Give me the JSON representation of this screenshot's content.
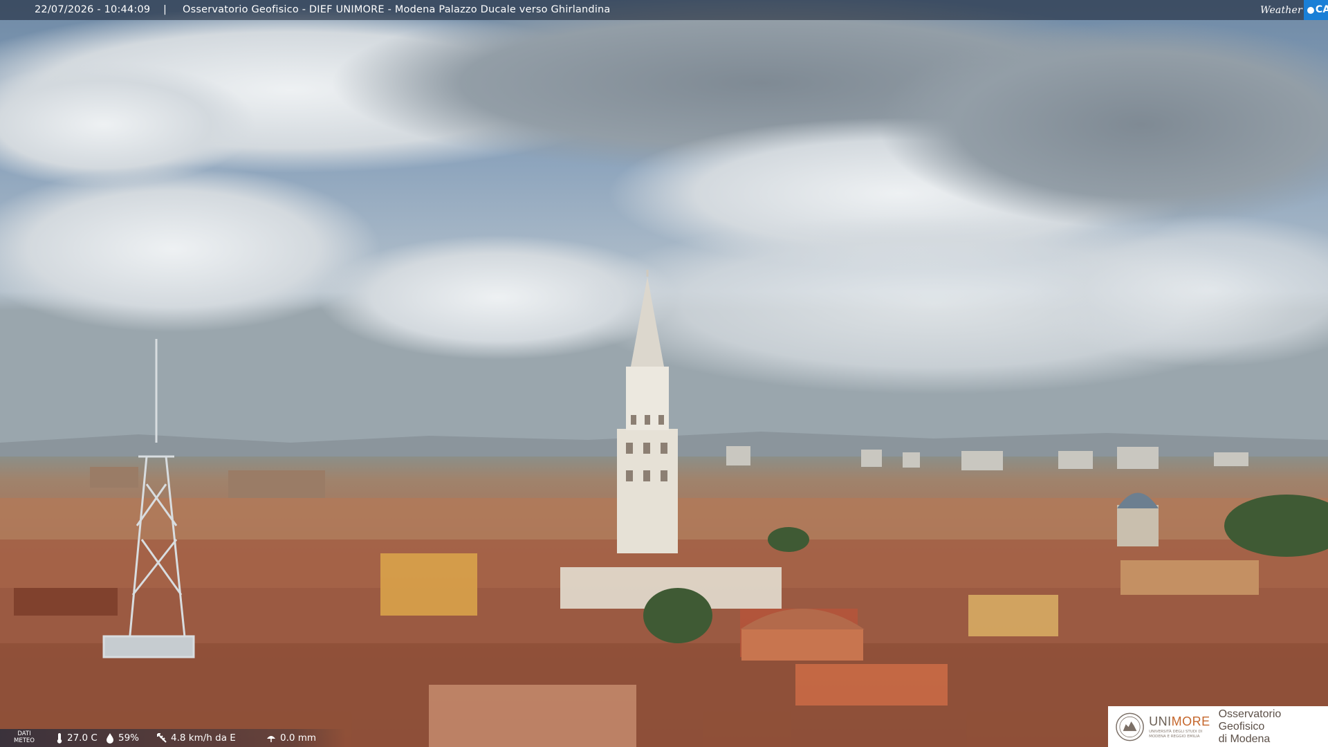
{
  "header": {
    "timestamp": "22/07/2026 - 10:44:09",
    "separator": "|",
    "title": "Osservatorio Geofisico - DIEF UNIMORE - Modena Palazzo Ducale verso Ghirlandina"
  },
  "brand": {
    "weather": "Weather",
    "cam": "CAM",
    "accent": "#1a7fd6"
  },
  "meteo": {
    "label_line1": "DATI",
    "label_line2": "METEO",
    "temperature": "27.0 C",
    "humidity": "59%",
    "wind": "4.8 km/h da E",
    "rain": "0.0 mm"
  },
  "institution": {
    "uni": "UNI",
    "more": "MORE",
    "tagline_line1": "UNIVERSITÀ DEGLI STUDI DI",
    "tagline_line2": "MODENA E REGGIO EMILIA",
    "observatory_line1": "Osservatorio Geofisico",
    "observatory_line2": "di Modena"
  },
  "scene": {
    "icons": [
      "thermometer-icon",
      "humidity-icon",
      "wind-icon",
      "rain-icon"
    ],
    "sky_color": "#8aa3bd",
    "roof_color": "#a8664a"
  }
}
